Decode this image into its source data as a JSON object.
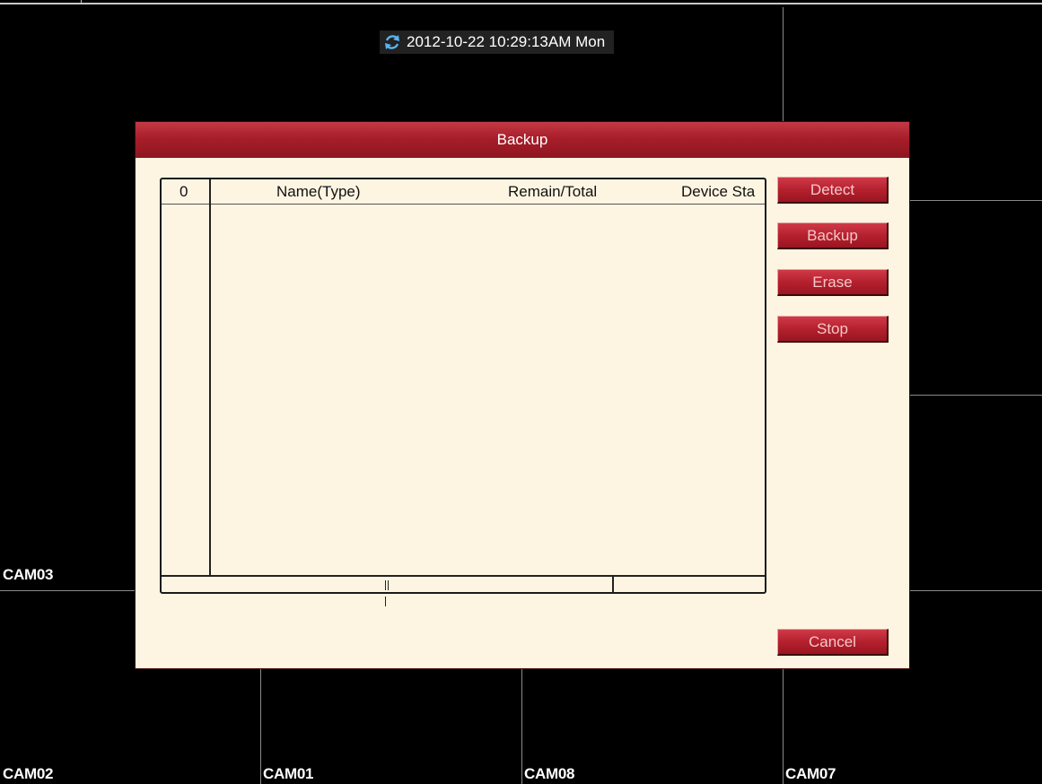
{
  "datetime": "2012-10-22 10:29:13AM Mon",
  "cameras": {
    "cam03": "CAM03",
    "cam02": "CAM02",
    "cam01": "CAM01",
    "cam08": "CAM08",
    "cam07": "CAM07"
  },
  "dialog": {
    "title": "Backup",
    "table": {
      "columns": [
        "0",
        "Name(Type)",
        "Remain/Total",
        "Device Sta"
      ],
      "rows": []
    },
    "buttons": {
      "detect": "Detect",
      "backup": "Backup",
      "erase": "Erase",
      "stop": "Stop",
      "cancel": "Cancel"
    }
  },
  "colors": {
    "title_bar": "#a81e2a",
    "dialog_bg": "#fdf5e2",
    "button": "#b5202e",
    "background": "#000000"
  }
}
